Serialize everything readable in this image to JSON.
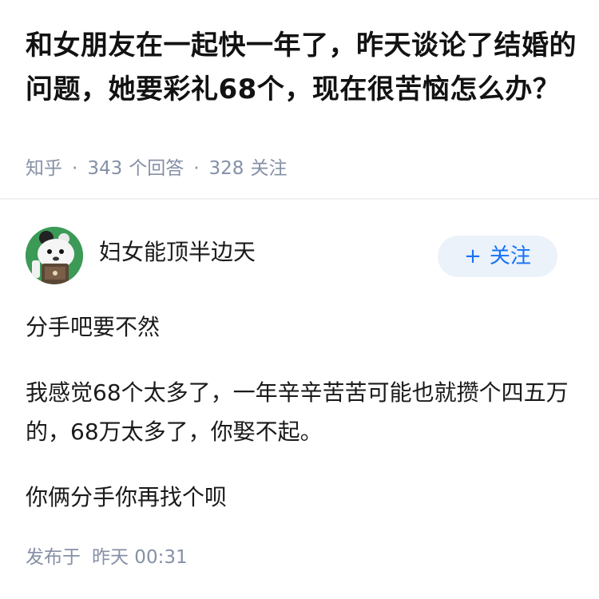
{
  "question": {
    "title": "和女朋友在一起快一年了，昨天谈论了结婚的问题，她要彩礼68个，现在很苦恼怎么办？",
    "source": "知乎",
    "separator": "·",
    "answer_count": "343",
    "answer_label": "个回答",
    "follower_count": "328",
    "follower_label": "关注"
  },
  "author": {
    "name": "妇女能顶半边天",
    "avatar_icon": "cartoon-character-avatar-icon",
    "follow_icon": "plus-icon",
    "follow_plus": "+",
    "follow_label": "关注"
  },
  "answer": {
    "paragraphs": [
      "分手吧要不然",
      "我感觉68个太多了，一年辛辛苦苦可能也就攒个四五万的，68万太多了，你娶不起。",
      "你俩分手你再找个呗"
    ],
    "published_label": "发布于",
    "published_time": "昨天 00:31"
  },
  "colors": {
    "title": "#121212",
    "meta": "#8590a6",
    "accent": "#1772f6",
    "follow_bg": "#ebf2fa",
    "avatar_bg": "#3c9a57",
    "divider": "#f0f0f2"
  }
}
